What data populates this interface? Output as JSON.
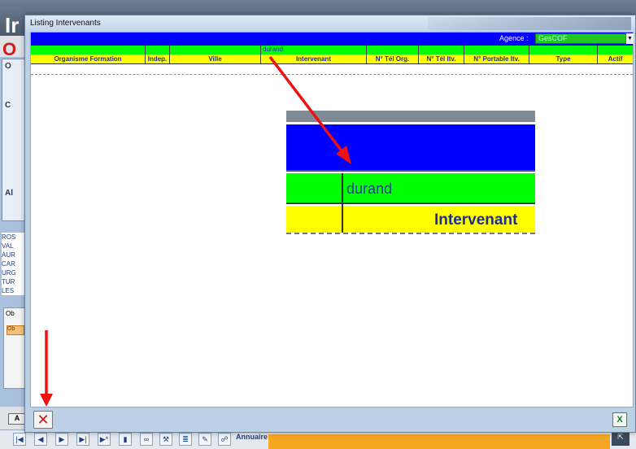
{
  "dialog": {
    "title": "Listing Intervenants",
    "agence_label": "Agence :",
    "agence_value": "GesCOF"
  },
  "table": {
    "filter_text": "durand",
    "columns": [
      "Organisme Formation",
      "Indep.",
      "Ville",
      "Intervenant",
      "N° Tél Org.",
      "N° Tél Itv.",
      "N° Portable Itv.",
      "Type",
      "Actif"
    ]
  },
  "zoom": {
    "filter_text": "durand",
    "header_text": "Intervenant"
  },
  "background": {
    "title_letter": "Ir",
    "o_letter": "O",
    "side_letters": [
      "O",
      "C",
      "Al"
    ],
    "list_items": [
      "ROS",
      "VAL",
      "AUR",
      "CAR",
      "URG",
      "TUR",
      "LES"
    ],
    "ob_label": "Ob",
    "ob_tab": "Ob",
    "a_button": "A",
    "annuaire": "Annuaire"
  },
  "colors": {
    "blue_bar": "#0000ff",
    "filter_row": "#00ff00",
    "header_row": "#ffff00",
    "arrow": "#ee1111"
  },
  "icons": {
    "close": "close-x-icon",
    "excel": "excel-export-icon"
  }
}
